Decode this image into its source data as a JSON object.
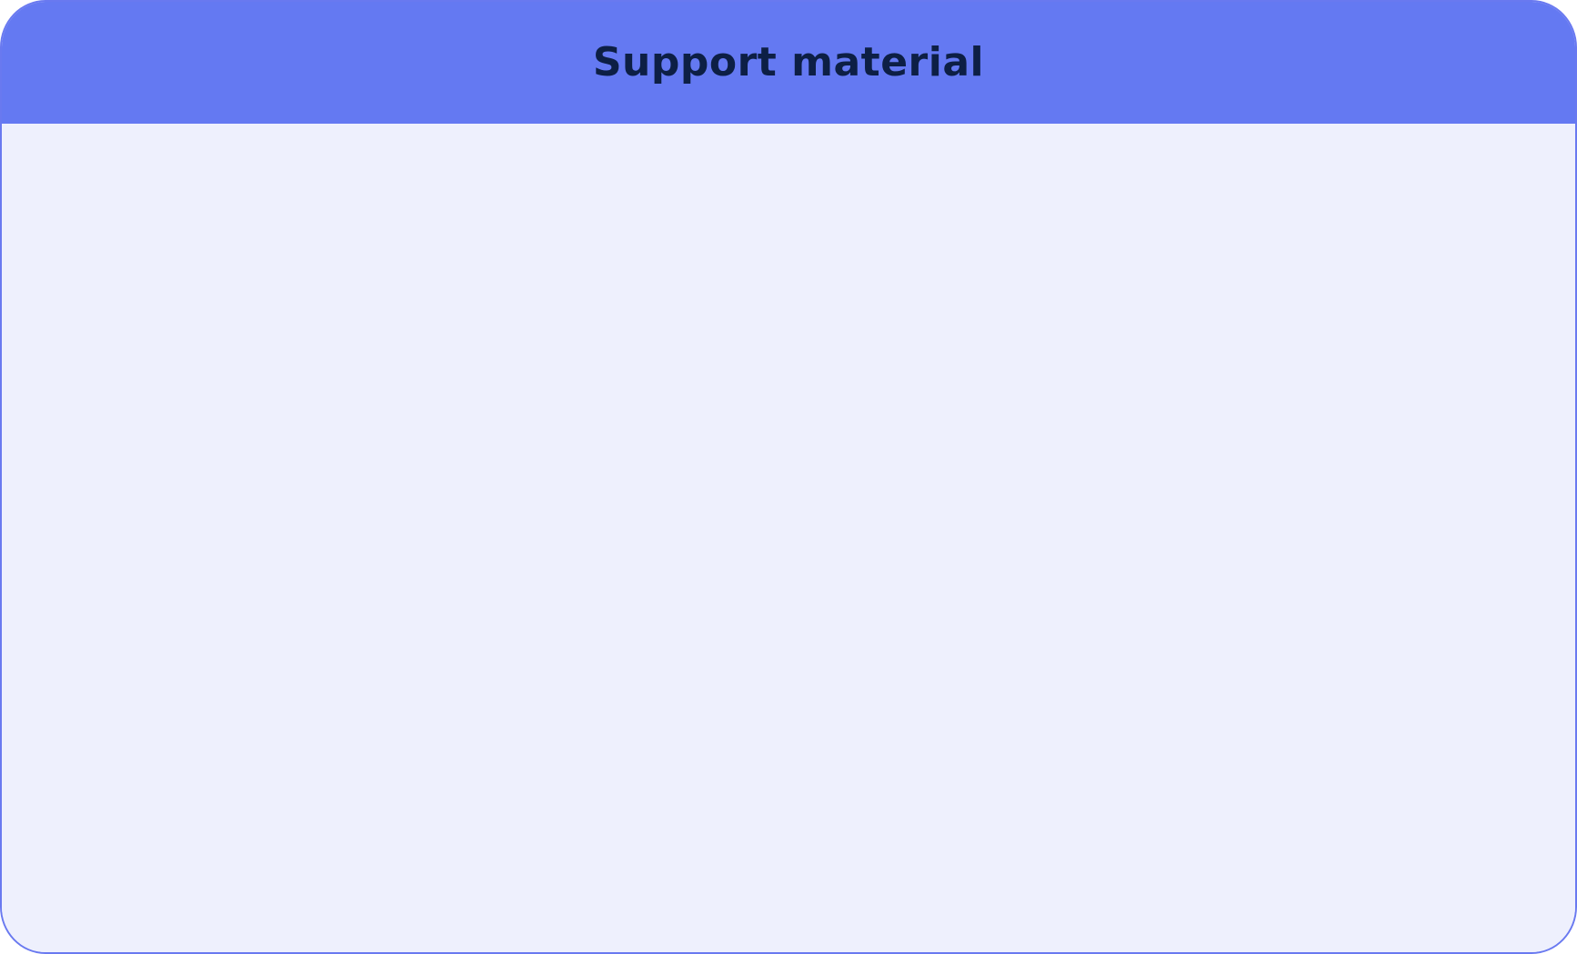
{
  "panel": {
    "title": "Support material"
  },
  "colors": {
    "header_background": "#6479f2",
    "body_background": "#eef0fd",
    "border": "#6979f0",
    "title_text": "#0d1f45"
  }
}
